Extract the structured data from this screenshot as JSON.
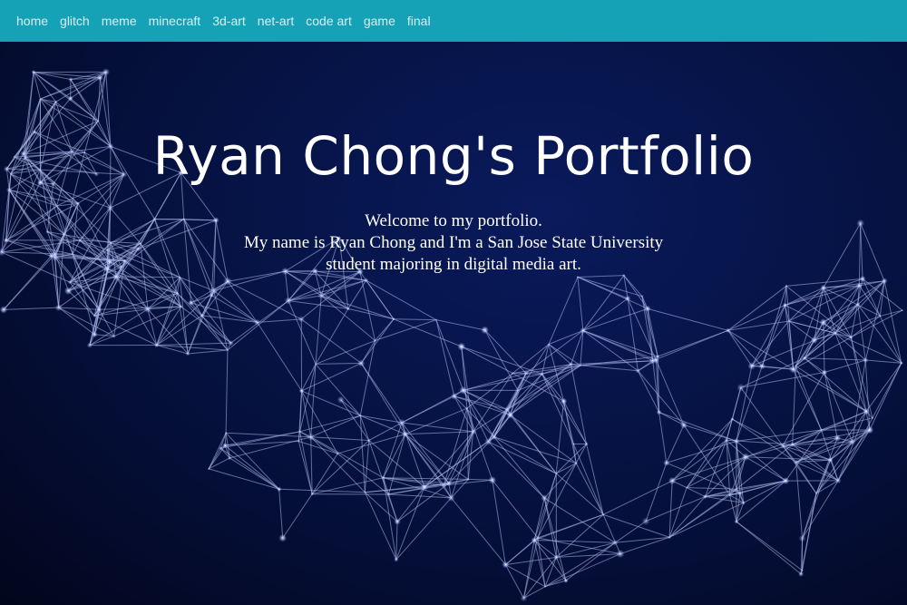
{
  "nav": {
    "items": [
      {
        "label": "home"
      },
      {
        "label": "glitch"
      },
      {
        "label": "meme"
      },
      {
        "label": "minecraft"
      },
      {
        "label": "3d-art"
      },
      {
        "label": "net-art"
      },
      {
        "label": "code art"
      },
      {
        "label": "game"
      },
      {
        "label": "final"
      }
    ]
  },
  "hero": {
    "title": "Ryan Chong's Portfolio",
    "line1": "Welcome to my portfolio.",
    "line2": "My name is Ryan Chong and I'm a San Jose State University",
    "line3": "student majoring in digital media art."
  },
  "colors": {
    "navbar": "#16a2b6",
    "background": "#061448",
    "text": "#ffffff"
  }
}
